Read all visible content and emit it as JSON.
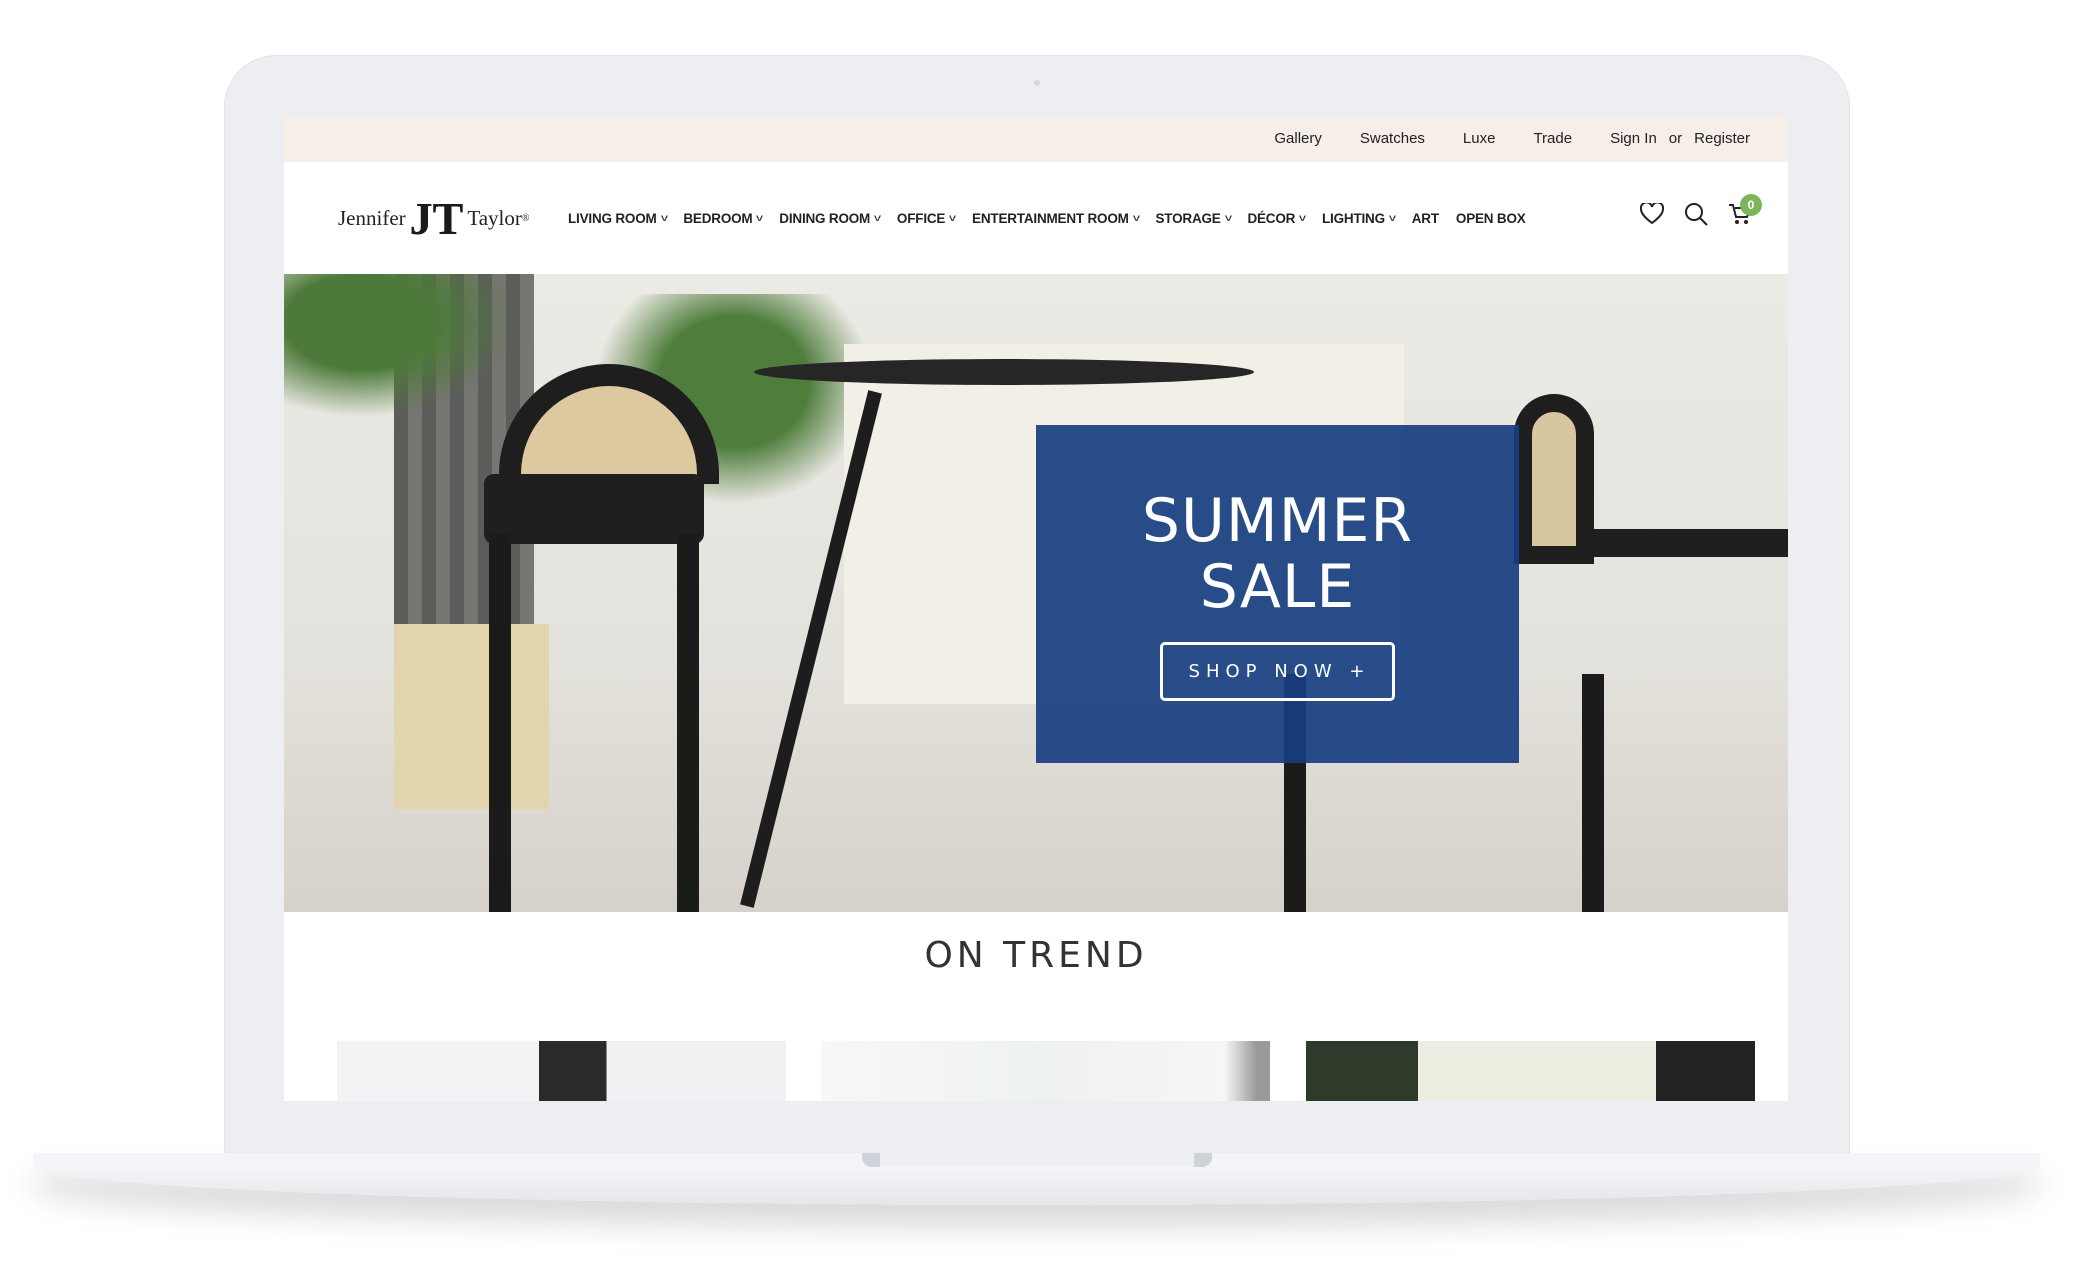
{
  "topbar": {
    "links": [
      "Gallery",
      "Swatches",
      "Luxe",
      "Trade"
    ],
    "sign_in": "Sign In",
    "or": "or",
    "register": "Register"
  },
  "logo": {
    "first": "Jennifer",
    "mono": "JT",
    "last": "Taylor",
    "reg": "®"
  },
  "nav": {
    "items": [
      {
        "label": "LIVING ROOM",
        "dropdown": true
      },
      {
        "label": "BEDROOM",
        "dropdown": true
      },
      {
        "label": "DINING ROOM",
        "dropdown": true
      },
      {
        "label": "OFFICE",
        "dropdown": true
      },
      {
        "label": "ENTERTAINMENT ROOM",
        "dropdown": true
      },
      {
        "label": "STORAGE",
        "dropdown": true
      },
      {
        "label": "DÉCOR",
        "dropdown": true
      },
      {
        "label": "LIGHTING",
        "dropdown": true
      },
      {
        "label": "ART",
        "dropdown": false
      },
      {
        "label": "OPEN BOX",
        "dropdown": false
      }
    ],
    "icons": [
      "heart-icon",
      "search-icon",
      "cart-icon"
    ],
    "cart_count": "0"
  },
  "hero": {
    "title_line1": "SUMMER",
    "title_line2": "SALE",
    "cta": "SHOP NOW +"
  },
  "section": {
    "title": "ON TREND"
  },
  "colors": {
    "accent": "#7cb55a",
    "banner_blue": "#173e80",
    "topbar_bg": "#f6eee8"
  }
}
